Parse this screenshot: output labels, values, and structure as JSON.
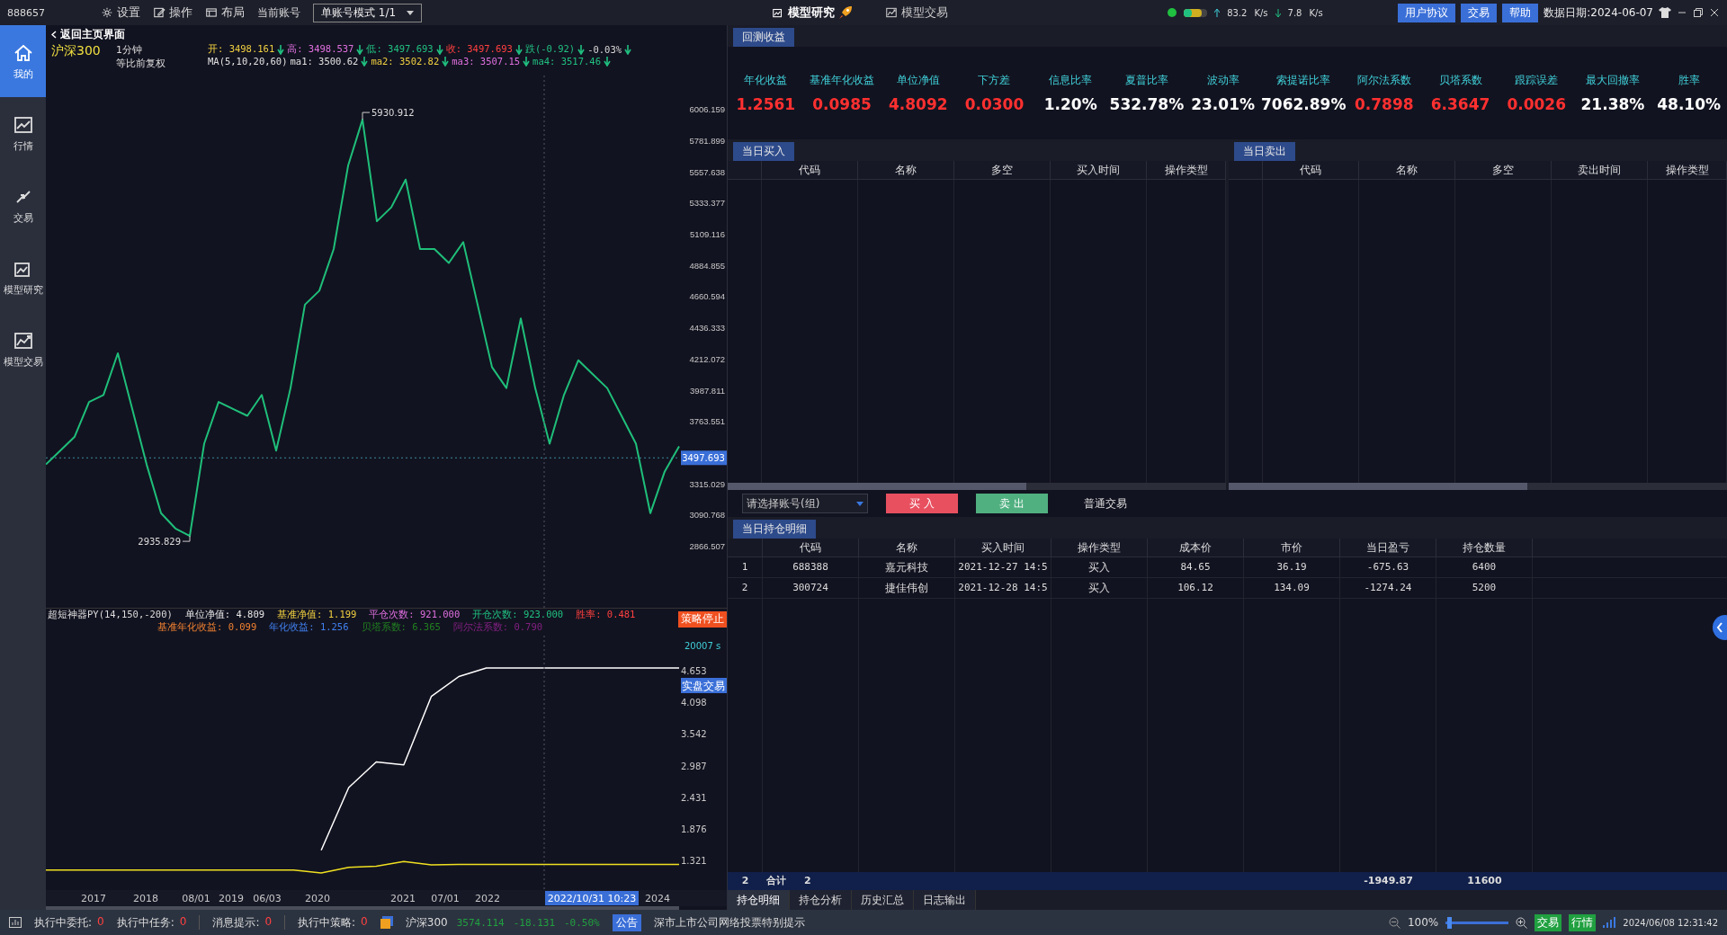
{
  "top_bar": {
    "account": "888657",
    "menu": [
      {
        "label": "设置",
        "kind": "gear"
      },
      {
        "label": "操作",
        "kind": "edit"
      },
      {
        "label": "布局",
        "kind": "layout"
      }
    ],
    "account_label": "当前账号",
    "account_mode": "单账号模式 1/1",
    "modules": [
      {
        "label": "模型研究",
        "kind": "research",
        "selected": true
      },
      {
        "label": "模型交易",
        "kind": "trading",
        "selected": false
      }
    ],
    "upload_speed": "83.2",
    "upload_unit": "K/s",
    "download_speed": "7.8",
    "download_unit": "K/s",
    "buttons": [
      "用户协议",
      "交易",
      "帮助"
    ],
    "data_date": "数据日期:2024-06-07"
  },
  "sidebar": {
    "items": [
      {
        "label": "我的",
        "kind": "home",
        "selected": true
      },
      {
        "label": "行情",
        "kind": "chart",
        "selected": false
      },
      {
        "label": "交易",
        "kind": "trade",
        "selected": false
      },
      {
        "label": "模型研究",
        "kind": "research",
        "selected": false
      },
      {
        "label": "模型交易",
        "kind": "trading",
        "selected": false
      }
    ]
  },
  "chart_header": {
    "back": "返回主页界面",
    "symbol": "沪深300",
    "period": "1分钟",
    "adjust": "等比前复权",
    "quote": [
      {
        "text": "开: 3498.161",
        "color": "#f0d040"
      },
      {
        "text": "高: 3498.537",
        "color": "#e070e0"
      },
      {
        "text": "低: 3497.693",
        "color": "#20c080"
      },
      {
        "text": "收: 3497.693",
        "color": "#ff4040"
      },
      {
        "text": "跌(-0.92)",
        "color": "#20c080"
      },
      {
        "text": "-0.03%",
        "color": "#d8d8d8"
      }
    ],
    "ma": [
      {
        "text": "MA(5,10,20,60)",
        "color": "#e0e0e0",
        "arrow": false
      },
      {
        "text": "ma1: 3500.62",
        "color": "#e0e0e0",
        "arrow": true
      },
      {
        "text": "ma2: 3502.82",
        "color": "#f0d040",
        "arrow": true
      },
      {
        "text": "ma3: 3507.15",
        "color": "#e070e0",
        "arrow": true
      },
      {
        "text": "ma4: 3517.46",
        "color": "#20c080",
        "arrow": true
      }
    ]
  },
  "price_chart": {
    "current_price": "3497.693",
    "chart_data": {
      "type": "line",
      "ylim": [
        2399.8,
        6248.6
      ],
      "ref_lines": [
        {
          "axis": "y",
          "value": 3497.693
        }
      ],
      "yticks": [
        6006.159,
        5781.899,
        5557.638,
        5333.377,
        5109.116,
        4884.855,
        4660.594,
        4436.333,
        4212.072,
        3987.811,
        3763.551,
        3315.029,
        3090.768,
        2866.507
      ],
      "series": [
        {
          "color": "#1fbf7a",
          "values": [
            3450,
            3550,
            3650,
            3900,
            3950,
            4250,
            3850,
            3450,
            3100,
            2990,
            2936,
            3600,
            3900,
            3850,
            3800,
            3950,
            3550,
            4000,
            4600,
            4700,
            5000,
            5600,
            5931,
            5200,
            5300,
            5500,
            5000,
            5000,
            4900,
            5050,
            4600,
            4150,
            4000,
            4500,
            4000,
            3600,
            3950,
            4200,
            4100,
            4000,
            3800,
            3600,
            3100,
            3400,
            3580
          ]
        }
      ],
      "annotations": [
        {
          "text": "5930.912"
        },
        {
          "text": "2935.829"
        }
      ]
    }
  },
  "strategy": {
    "name": "超短神器PY(14,150,-200)",
    "status": "策略停止",
    "stats": [
      {
        "text": "单位净值: 4.809",
        "color": "#e8e8e8"
      },
      {
        "text": "基准净值: 1.199",
        "color": "#f0d040"
      },
      {
        "text": "平仓次数: 921.000",
        "color": "#e070e0"
      },
      {
        "text": "开仓次数: 923.000",
        "color": "#20c080"
      },
      {
        "text": "胜率: 0.481",
        "color": "#ff4040"
      }
    ],
    "stats_2": [
      {
        "text": "基准年化收益: 0.099",
        "color": "#f08030"
      },
      {
        "text": "年化收益: 1.256",
        "color": "#4080f0"
      },
      {
        "text": "贝塔系数: 6.365",
        "color": "#208020"
      },
      {
        "text": "阿尔法系数: 0.790",
        "color": "#802080"
      }
    ],
    "elapsed": "20007 s",
    "mode": "实盘交易",
    "chart_data": {
      "type": "line",
      "ylim": [
        0.8,
        5.269
      ],
      "yticks": [
        4.653,
        4.098,
        3.542,
        2.987,
        2.431,
        1.876,
        1.321
      ],
      "series": [
        {
          "color": "#ffffff",
          "values": [
            null,
            null,
            null,
            null,
            null,
            null,
            null,
            null,
            null,
            null,
            1.5,
            2.6,
            3.05,
            3.0,
            4.2,
            4.55,
            4.7,
            4.7,
            4.7,
            4.7,
            4.7,
            4.7,
            4.7,
            4.7
          ]
        },
        {
          "color": "#f0e020",
          "values": [
            1.15,
            1.15,
            1.15,
            1.15,
            1.15,
            1.15,
            1.15,
            1.15,
            1.15,
            1.15,
            1.1,
            1.2,
            1.22,
            1.3,
            1.24,
            1.25,
            1.25,
            1.25,
            1.25,
            1.25,
            1.25,
            1.25,
            1.25,
            1.25
          ]
        }
      ]
    },
    "time_axis": [
      {
        "label": "2017",
        "highlighted": false
      },
      {
        "label": "2018",
        "highlighted": false
      },
      {
        "label": "08/01",
        "highlighted": false
      },
      {
        "label": "2019",
        "highlighted": false
      },
      {
        "label": "06/03",
        "highlighted": false
      },
      {
        "label": "2020",
        "highlighted": false
      },
      {
        "label": "2021",
        "highlighted": false
      },
      {
        "label": "07/01",
        "highlighted": false
      },
      {
        "label": "2022",
        "highlighted": false
      },
      {
        "label": "2022/10/31 10:23",
        "highlighted": true
      },
      {
        "label": "2024",
        "highlighted": false
      }
    ]
  },
  "backtest": {
    "tab": "回测收益",
    "metrics": [
      {
        "label": "年化收益",
        "value": "1.2561",
        "color": "#ff3030"
      },
      {
        "label": "基准年化收益",
        "value": "0.0985",
        "color": "#ff3030"
      },
      {
        "label": "单位净值",
        "value": "4.8092",
        "color": "#ff3030"
      },
      {
        "label": "下方差",
        "value": "0.0300",
        "color": "#ff3030"
      },
      {
        "label": "信息比率",
        "value": "1.20%",
        "color": "#ffffff"
      },
      {
        "label": "夏普比率",
        "value": "532.78%",
        "color": "#ffffff"
      },
      {
        "label": "波动率",
        "value": "23.01%",
        "color": "#ffffff"
      },
      {
        "label": "索提诺比率",
        "value": "7062.89%",
        "color": "#ffffff"
      },
      {
        "label": "阿尔法系数",
        "value": "0.7898",
        "color": "#ff3030"
      },
      {
        "label": "贝塔系数",
        "value": "6.3647",
        "color": "#ff3030"
      },
      {
        "label": "跟踪误差",
        "value": "0.0026",
        "color": "#ff3030"
      },
      {
        "label": "最大回撤率",
        "value": "21.38%",
        "color": "#ffffff"
      },
      {
        "label": "胜率",
        "value": "48.10%",
        "color": "#ffffff"
      }
    ]
  },
  "buy_panel": {
    "title": "当日买入",
    "columns": [
      "代码",
      "名称",
      "多空",
      "买入时间",
      "操作类型"
    ]
  },
  "sell_panel": {
    "title": "当日卖出",
    "columns": [
      "代码",
      "名称",
      "多空",
      "卖出时间",
      "操作类型"
    ]
  },
  "controls": {
    "account_select": {
      "placeholder": "请选择账号(组)"
    },
    "buy_button": "买 入",
    "sell_button": "卖 出",
    "mode": "普通交易"
  },
  "holdings": {
    "title": "当日持仓明细",
    "columns": [
      "代码",
      "名称",
      "买入时间",
      "操作类型",
      "成本价",
      "市价",
      "当日盈亏",
      "持仓数量"
    ],
    "rows": [
      {
        "index": "1",
        "cells": [
          "688388",
          "嘉元科技",
          "2021-12-27 14:5",
          "买入",
          "84.65",
          "36.19",
          "-675.63",
          "6400"
        ]
      },
      {
        "index": "2",
        "cells": [
          "300724",
          "捷佳伟创",
          "2021-12-28 14:5",
          "买入",
          "106.12",
          "134.09",
          "-1274.24",
          "5200"
        ]
      }
    ],
    "total": {
      "index": "2",
      "label": "合计",
      "count": "2",
      "pnl": "-1949.87",
      "quantity": "11600"
    }
  },
  "bottom_tabs": [
    {
      "label": "持仓明细",
      "selected": true
    },
    {
      "label": "持仓分析",
      "selected": false
    },
    {
      "label": "历史汇总",
      "selected": false
    },
    {
      "label": "日志输出",
      "selected": false
    }
  ],
  "status_bar": {
    "counters": [
      {
        "label": "执行中委托:",
        "value": "0"
      },
      {
        "label": "执行中任务:",
        "value": "0"
      },
      {
        "label": "消息提示:",
        "value": "0"
      },
      {
        "label": "执行中策略:",
        "value": "0"
      }
    ],
    "index": {
      "name": "沪深300",
      "price": "3574.114",
      "change": "-18.131",
      "percent": "-0.50%"
    },
    "notice": {
      "badge": "公告",
      "text": "深市上市公司网络投票特别提示"
    },
    "zoom": {
      "value": "100%",
      "level": 0.02
    },
    "badges": [
      "交易",
      "行情"
    ],
    "time": "2024/06/08 12:31:42"
  }
}
